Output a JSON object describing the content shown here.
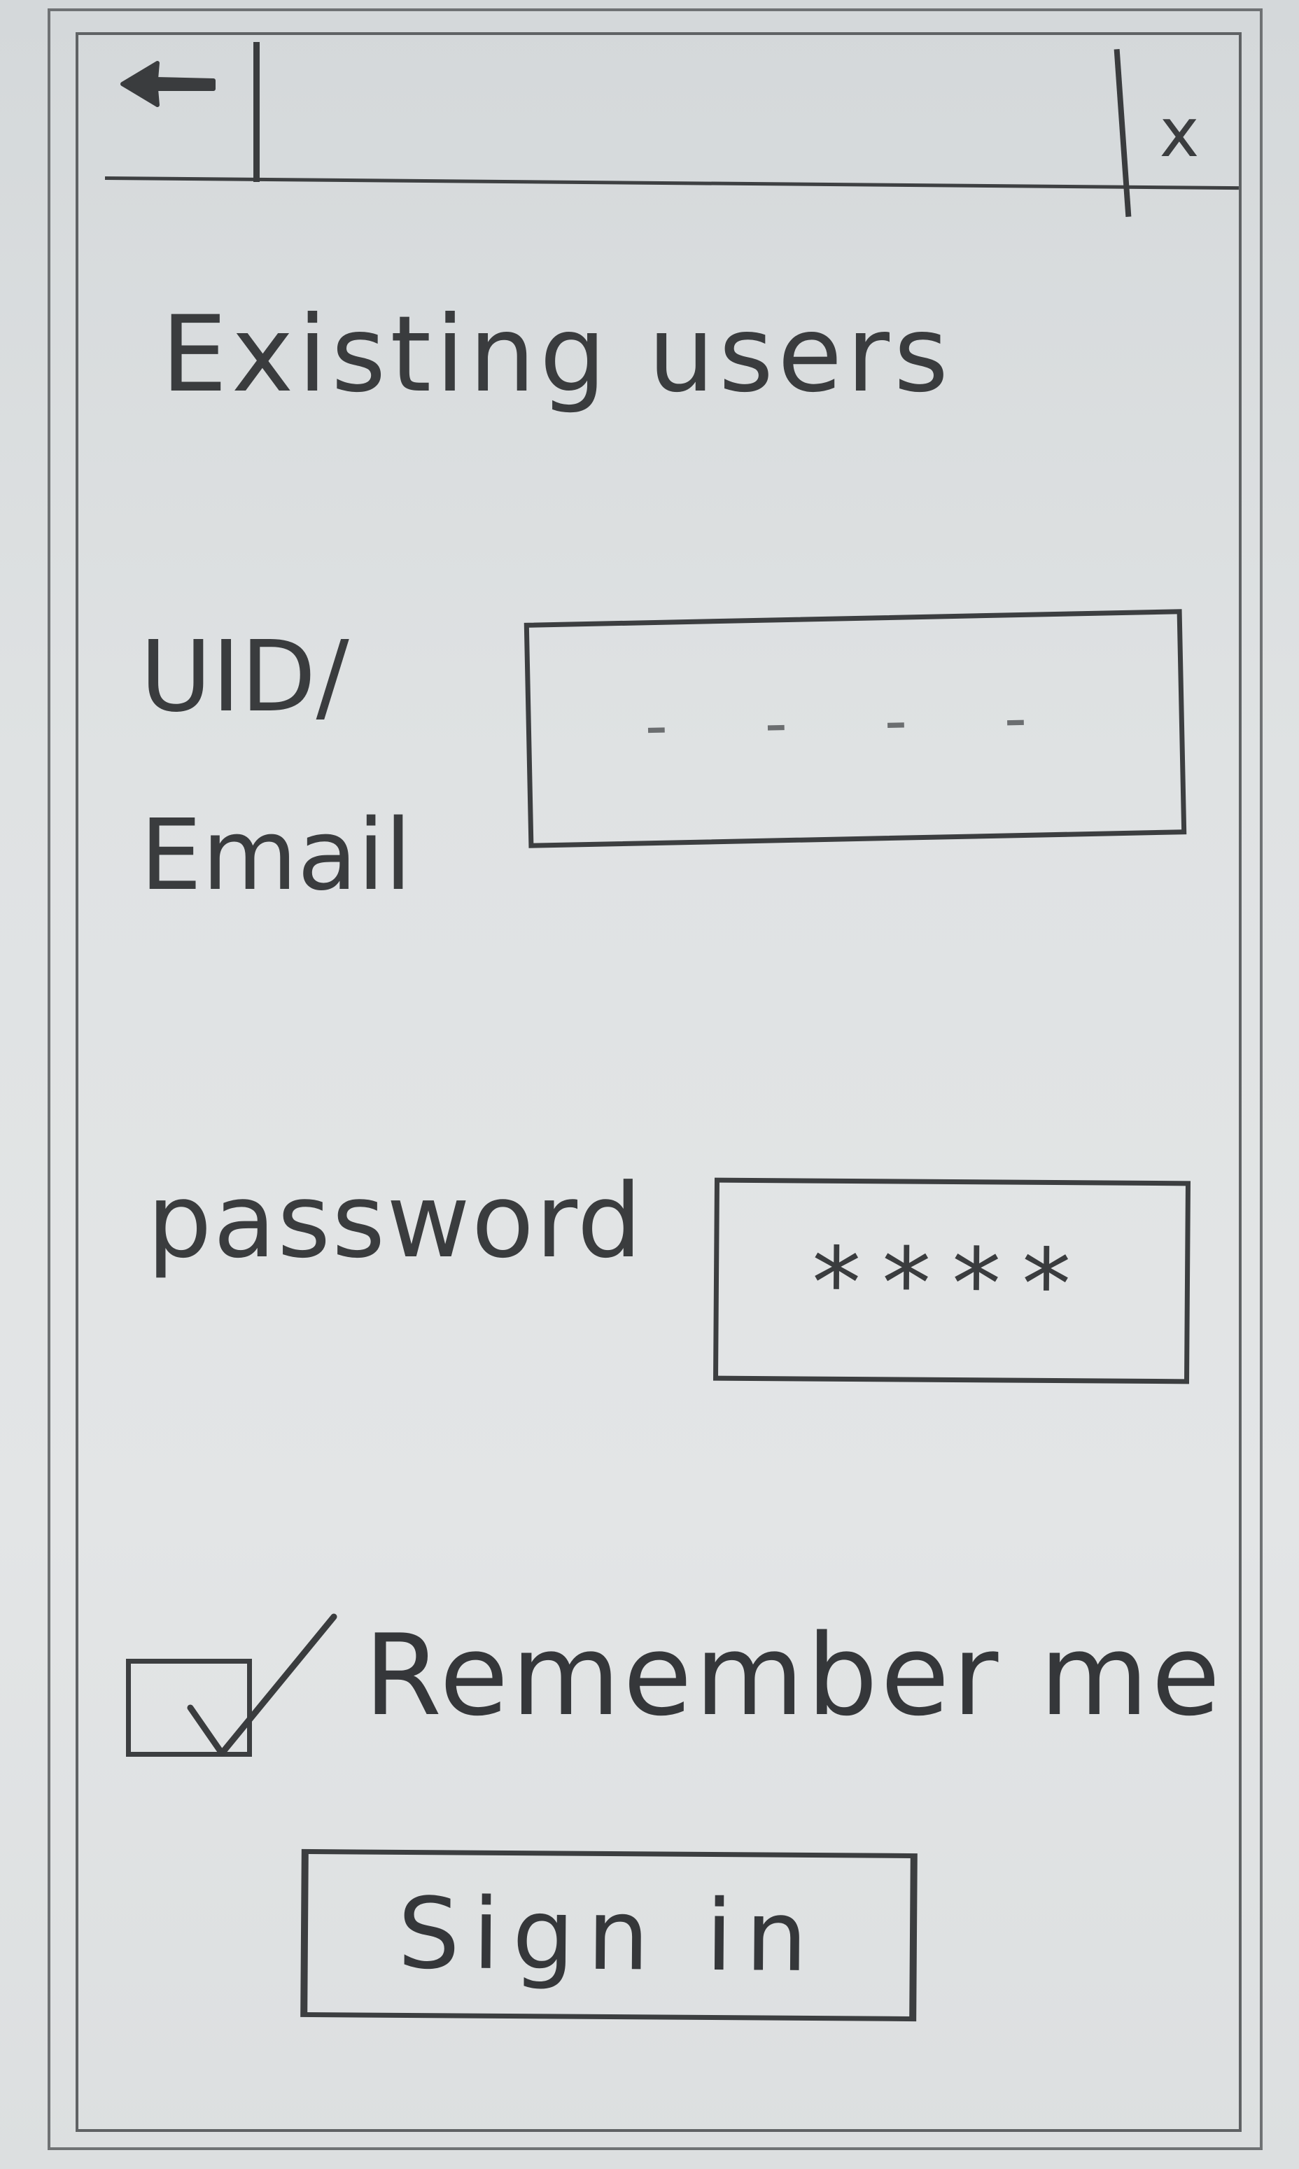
{
  "header": {
    "back_icon": "arrow-left-icon",
    "close_label": "x"
  },
  "title": "Existing users",
  "form": {
    "uid_label": "UID/ Email",
    "uid_value": "- - - -",
    "password_label": "password",
    "password_value": "****",
    "remember_label": "Remember me",
    "remember_checked": true
  },
  "actions": {
    "signin_label": "Sign in"
  }
}
